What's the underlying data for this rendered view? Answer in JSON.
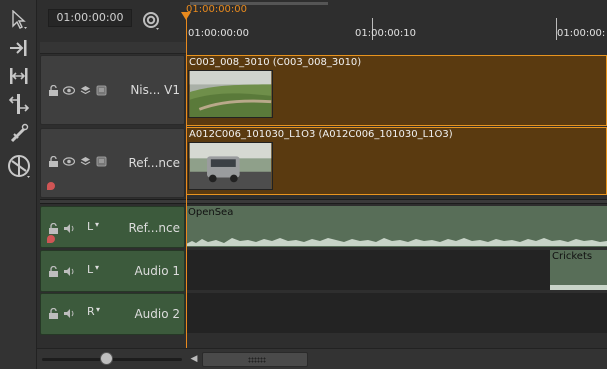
{
  "toolbar": {
    "timecode": "01:00:00:00",
    "tools": [
      {
        "icon": "select-arrow-icon"
      },
      {
        "icon": "move-to-end-icon"
      },
      {
        "icon": "ripple-trim-icon"
      },
      {
        "icon": "slip-icon"
      },
      {
        "icon": "razor-icon"
      },
      {
        "icon": "multi-tool-icon"
      }
    ]
  },
  "ruler": {
    "playhead_timecode": "01:00:00:00",
    "labels": [
      "01:00:00:00",
      "01:00:00:10",
      "01:00:00:"
    ]
  },
  "tracks": {
    "video": [
      {
        "name": "Nis... V1",
        "clip": {
          "label": "C003_008_3010 (C003_008_3010)"
        }
      },
      {
        "name": "Ref...nce",
        "clip": {
          "label": "A012C006_101030_L1O3 (A012C006_101030_L1O3)"
        }
      }
    ],
    "audio": [
      {
        "name": "Ref...nce",
        "channel": "L",
        "clip": {
          "label": "OpenSea"
        }
      },
      {
        "name": "Audio 1",
        "channel": "L",
        "clip": {
          "label": "Crickets"
        }
      },
      {
        "name": "Audio 2",
        "channel": "R"
      }
    ]
  },
  "colors": {
    "playhead": "#e88a1e",
    "video_clip_fill": "#5a3a10",
    "audio_clip_fill": "#586e58",
    "audio_track_header": "#3c5a3c"
  },
  "zoom": {
    "level": 0.46
  }
}
